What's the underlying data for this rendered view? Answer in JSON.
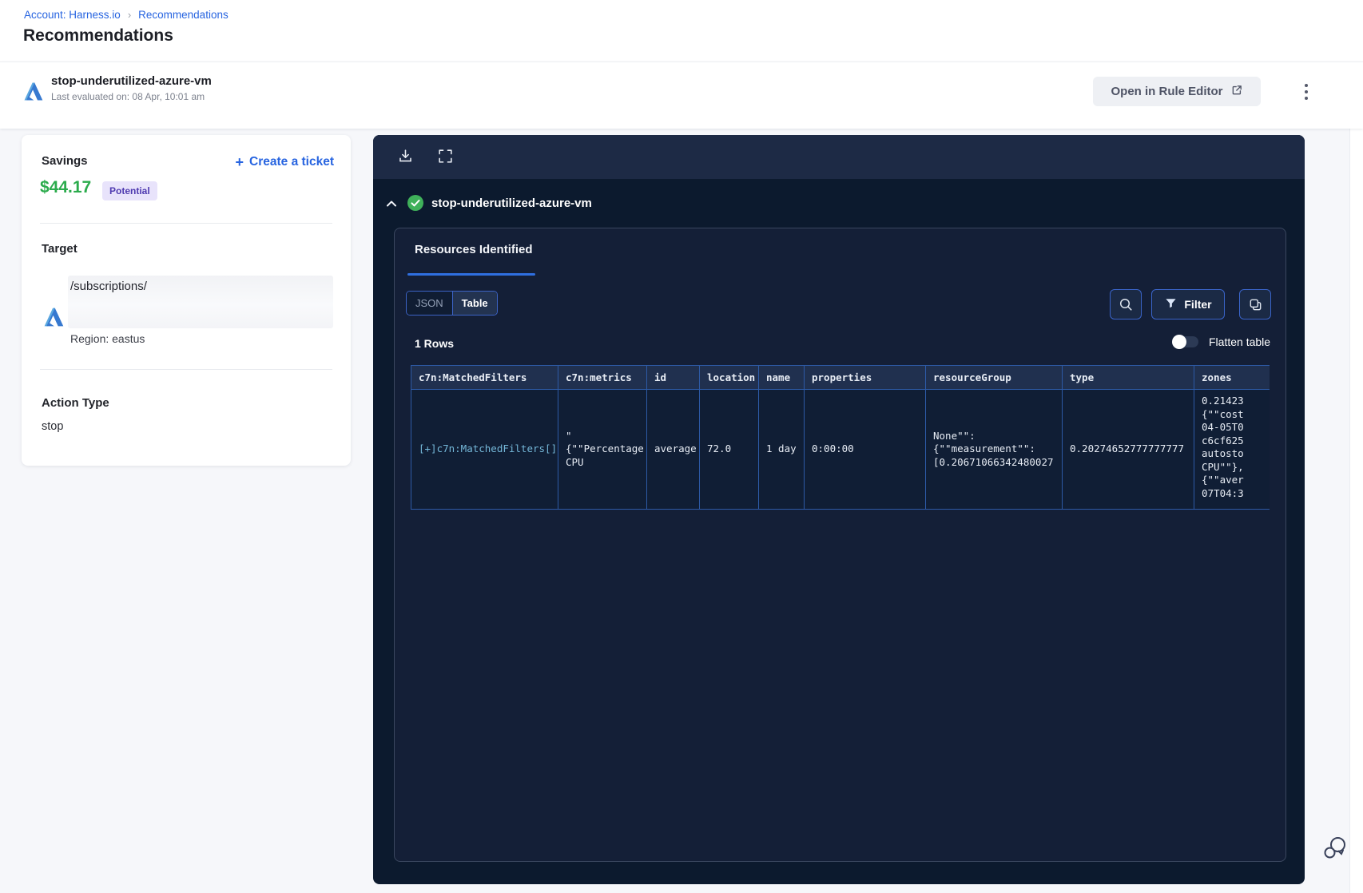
{
  "breadcrumb": {
    "account": "Account: Harness.io",
    "separator": "›",
    "page": "Recommendations"
  },
  "page_title": "Recommendations",
  "header": {
    "name": "stop-underutilized-azure-vm",
    "last_evaluated": "Last evaluated on: 08 Apr, 10:01 am",
    "open_rule_editor_label": "Open in Rule Editor"
  },
  "summary": {
    "savings_label": "Savings",
    "savings_value": "$44.17",
    "savings_badge": "Potential",
    "create_ticket_plus": "+",
    "create_ticket_label": "Create a ticket",
    "target_label": "Target",
    "target_path": "/subscriptions/",
    "region": "Region: eastus",
    "action_type_label": "Action Type",
    "action_type_value": "stop"
  },
  "panel": {
    "title": "stop-underutilized-azure-vm",
    "tab_label": "Resources Identified",
    "view_toggle": {
      "json_label": "JSON",
      "table_label": "Table",
      "selected": "Table"
    },
    "filter_label": "Filter",
    "rows_count": "1 Rows",
    "flatten_label": "Flatten table",
    "flatten_state": "off",
    "table": {
      "columns": [
        "c7n:MatchedFilters",
        "c7n:metrics",
        "id",
        "location",
        "name",
        "properties",
        "resourceGroup",
        "type",
        "zones"
      ],
      "rows": [
        {
          "c7n_matchedfilters": "[+]c7n:MatchedFilters[]",
          "c7n_metrics": "\"\n{\"\"Percentage\nCPU",
          "id": "average",
          "location": "72.0",
          "name": "1 day",
          "properties": "0:00:00",
          "resourceGroup": "None\"\":\n{\"\"measurement\"\":\n[0.20671066342480027",
          "type": "0.20274652777777777",
          "zones": "0.21423\n{\"\"cost\n04-05T0\nc6cf625\nautosto\nCPU\"\"},\n{\"\"aver\n07T04:3"
        }
      ]
    }
  },
  "icons": [
    "azure-logo",
    "external-link-icon",
    "kebab-menu-icon",
    "download-icon",
    "fullscreen-icon",
    "chevron-up-icon",
    "check-circle-icon",
    "search-icon",
    "filter-funnel-icon",
    "copy-icon",
    "toggle-switch",
    "chat-feedback-icon",
    "plus-icon"
  ],
  "colors": {
    "link_blue": "#2764e0",
    "savings_green": "#2bab4c",
    "badge_bg": "#e8e3fb",
    "badge_text": "#4e3ab0",
    "panel_body": "#0c1a2e",
    "panel_toolbar": "#1d2a45",
    "inner_card": "#141f37",
    "table_border": "#2d5aa6",
    "table_header_bg": "#20304f",
    "tab_underline": "#2f6fe0",
    "check_green": "#3fb15a"
  }
}
